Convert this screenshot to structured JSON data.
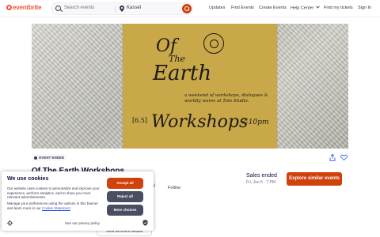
{
  "header": {
    "logo": "eventbrite",
    "search": {
      "placeholder": "Search events",
      "location": "Kassel"
    },
    "nav": [
      "Updates",
      "Find Events",
      "Create Events",
      "Help Center",
      "Find my tickets",
      "Sign In"
    ]
  },
  "banner": {
    "poster": {
      "line1": "Of",
      "line2": "The",
      "line3": "Earth",
      "subtitle": "a weekend of workshops, dialogues & worldly wares at Tom Studio.",
      "date": "[6.5]",
      "workshops": "Workshops",
      "time": "7-10pm"
    }
  },
  "event": {
    "status_badge": "EVENT ENDED",
    "title": "Of The Earth Workshops",
    "organizer_tail": "y",
    "follow_label": "Follow",
    "sales_status": "Sales ended",
    "sales_date": "Fri, Jun 5 · 7 PM",
    "explore_label": "Explore similar events",
    "view_all_label": "View all event details"
  },
  "cookie_banner": {
    "title": "We use cookies",
    "body1": "Our website uses cookies to personalize and improve your experience, perform analytics, and to show you more relevant advertisements.",
    "body2_prefix": "Manage your preferences using the options in this banner and learn more in our ",
    "body2_link": "Cookie Statement",
    "accept_label": "Accept all",
    "reject_label": "Reject all",
    "more_label": "More choices",
    "policy_label": "See our privacy policy"
  },
  "colors": {
    "brand": "#f05537",
    "cta": "#d1410c",
    "secondary_button": "#4b4d63",
    "poster": "#c9a84a"
  }
}
